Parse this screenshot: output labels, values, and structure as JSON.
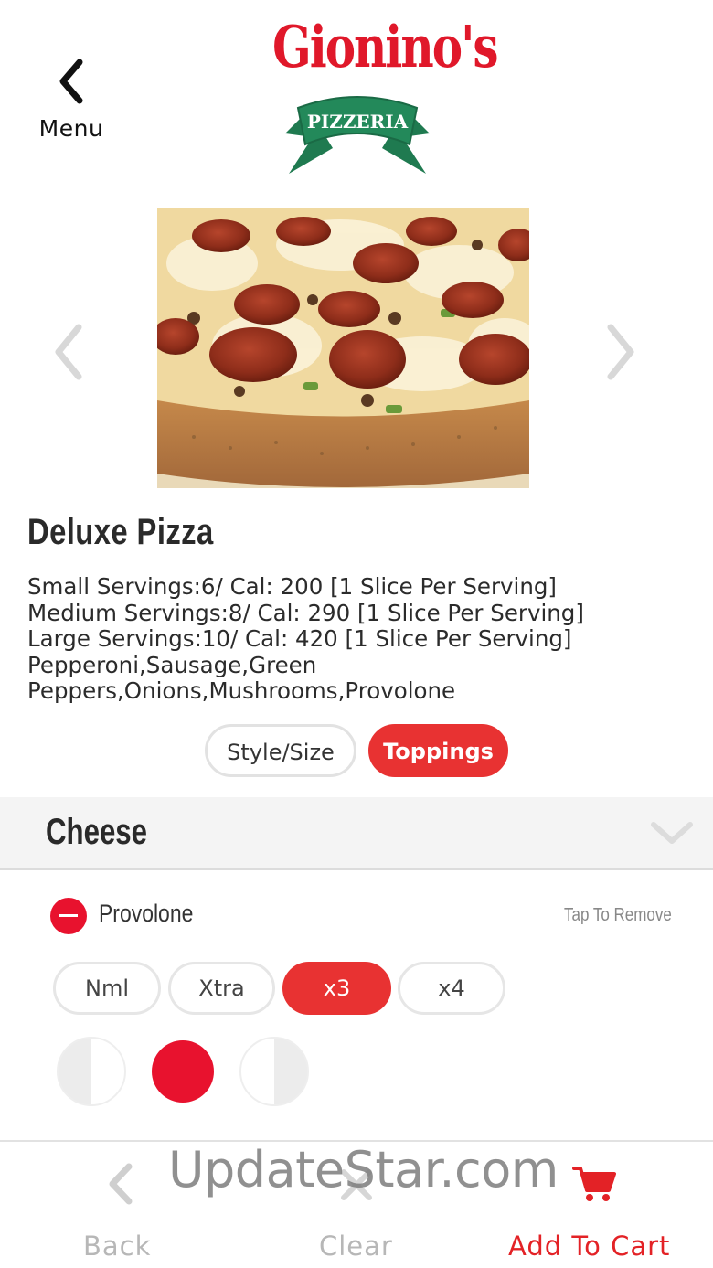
{
  "header": {
    "back_label": "Menu",
    "logo_name": "Gionino's",
    "logo_sub": "PIZZERIA"
  },
  "product": {
    "title": "Deluxe Pizza",
    "description_lines": [
      "Small Servings:6/ Cal: 200 [1 Slice Per Serving]",
      "Medium Servings:8/ Cal: 290 [1 Slice Per Serving]",
      "Large Servings:10/ Cal: 420 [1 Slice Per Serving]",
      "Pepperoni,Sausage,Green",
      "Peppers,Onions,Mushrooms,Provolone"
    ]
  },
  "tabs": [
    {
      "label": "Style/Size",
      "active": false
    },
    {
      "label": "Toppings",
      "active": true
    }
  ],
  "section": {
    "title": "Cheese",
    "icon": "chevron-down-icon"
  },
  "topping": {
    "name": "Provolone",
    "action_hint": "Tap To Remove",
    "amounts": [
      {
        "label": "Nml",
        "selected": false
      },
      {
        "label": "Xtra",
        "selected": false
      },
      {
        "label": "x3",
        "selected": true
      },
      {
        "label": "x4",
        "selected": false
      }
    ],
    "placement_selected": "whole"
  },
  "footer": {
    "back_label": "Back",
    "clear_label": "Clear",
    "cart_label": "Add To Cart"
  },
  "watermark": "UpdateStar.com",
  "colors": {
    "accent": "#e83232",
    "brand_red": "#e0182a",
    "brand_green": "#1f7a50",
    "inactive": "#b7b7b7"
  }
}
